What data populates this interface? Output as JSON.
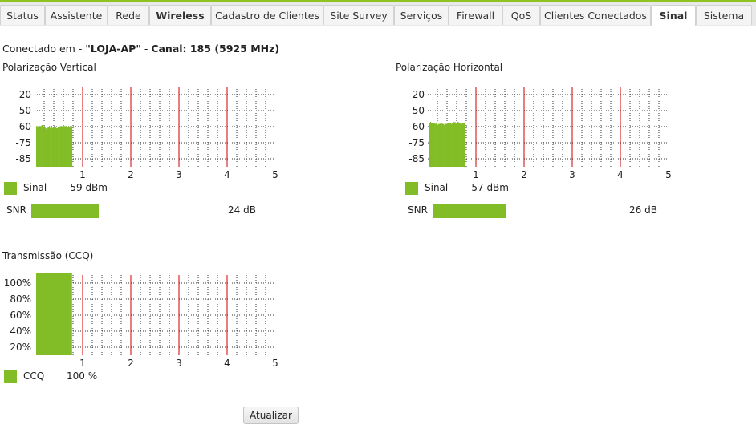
{
  "tabs": [
    {
      "label": "Status",
      "style": "normal"
    },
    {
      "label": "Assistente",
      "style": "normal"
    },
    {
      "label": "Rede",
      "style": "normal"
    },
    {
      "label": "Wireless",
      "style": "bold"
    },
    {
      "label": "Cadastro de Clientes",
      "style": "normal"
    },
    {
      "label": "Site Survey",
      "style": "normal"
    },
    {
      "label": "Serviços",
      "style": "normal"
    },
    {
      "label": "Firewall",
      "style": "normal"
    },
    {
      "label": "QoS",
      "style": "normal"
    },
    {
      "label": "Clientes Conectados",
      "style": "normal"
    },
    {
      "label": "Sinal",
      "style": "active"
    },
    {
      "label": "Sistema",
      "style": "normal"
    }
  ],
  "connection": {
    "prefix": "Conectado em - ",
    "ssid": "\"LOJA-AP\"",
    "separator": " - ",
    "channel": "Canal: 185 (5925 MHz)"
  },
  "signal_unit": "dBm",
  "snr_unit": "dB",
  "ccq_unit": "%",
  "colors": {
    "bar": "#82bd27",
    "marker": "#cc0000",
    "grid": "#333333",
    "accent": "#8fc31f"
  },
  "vertical": {
    "title": "Polarização Vertical",
    "legend_label": "Sinal",
    "value": "-59",
    "snr_label": "SNR",
    "snr_value": "24"
  },
  "horizontal": {
    "title": "Polarização Horizontal",
    "legend_label": "Sinal",
    "value": "-57",
    "snr_label": "SNR",
    "snr_value": "26"
  },
  "ccq": {
    "title": "Transmissão (CCQ)",
    "legend_label": "CCQ",
    "value": "100"
  },
  "refresh_label": "Atualizar",
  "chart_data": [
    {
      "type": "area",
      "name": "vertical",
      "y_ticks": [
        "-20",
        "-50",
        "-60",
        "-75",
        "-85"
      ],
      "x_ticks": [
        "1",
        "2",
        "3",
        "4",
        "5"
      ],
      "xlim": [
        0,
        5
      ],
      "grid": true,
      "filled_until_x": 0.78,
      "series": [
        {
          "values": [
            -57,
            -57,
            -58,
            -57,
            -58,
            -57,
            -57,
            -56,
            -57,
            -57,
            -58,
            -58,
            -59,
            -60,
            -59,
            -58,
            -58,
            -57,
            -59,
            -59,
            -58,
            -59,
            -58,
            -58,
            -57,
            -58,
            -59,
            -59,
            -58,
            -58,
            -58,
            -57,
            -58,
            -57,
            -58,
            -58,
            -57,
            -57,
            -57,
            -57,
            -58,
            -58,
            -58,
            -58,
            -57,
            -57,
            -57
          ]
        }
      ]
    },
    {
      "type": "area",
      "name": "horizontal",
      "y_ticks": [
        "-20",
        "-50",
        "-60",
        "-75",
        "-85"
      ],
      "x_ticks": [
        "1",
        "2",
        "3",
        "4",
        "5"
      ],
      "xlim": [
        0,
        5
      ],
      "grid": true,
      "filled_until_x": 0.78,
      "series": [
        {
          "values": [
            -54,
            -53,
            -54,
            -54,
            -55,
            -54,
            -54,
            -55,
            -54,
            -55,
            -56,
            -55,
            -55,
            -55,
            -54,
            -55,
            -54,
            -55,
            -55,
            -56,
            -54,
            -55,
            -55,
            -54,
            -54,
            -54,
            -54,
            -54,
            -55,
            -54,
            -54,
            -53,
            -54,
            -53,
            -55,
            -54,
            -53,
            -53,
            -54,
            -54,
            -54,
            -54,
            -55,
            -54,
            -54,
            -54,
            -54
          ]
        }
      ]
    },
    {
      "type": "area",
      "name": "ccq",
      "y_ticks": [
        "100%",
        "80%",
        "60%",
        "40%",
        "20%"
      ],
      "x_ticks": [
        "1",
        "2",
        "3",
        "4",
        "5"
      ],
      "xlim": [
        0,
        5
      ],
      "grid": true,
      "filled_until_x": 0.78,
      "series": [
        {
          "values": [
            100
          ]
        }
      ]
    }
  ]
}
